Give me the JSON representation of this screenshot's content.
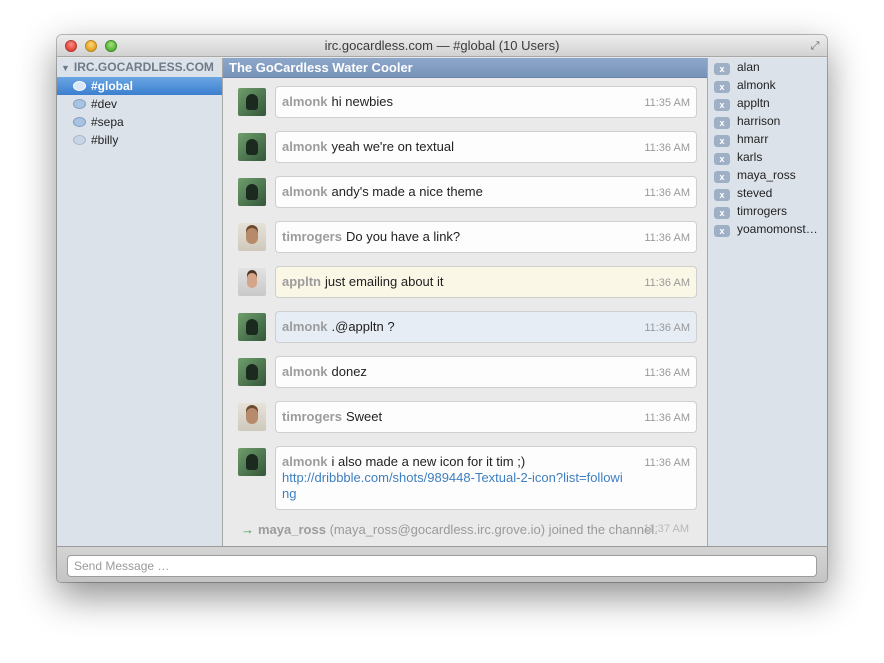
{
  "window": {
    "title": "irc.gocardless.com — #global (10 Users)"
  },
  "sidebar": {
    "server": "IRC.GOCARDLESS.COM",
    "channels": [
      {
        "name": "#global",
        "active": true
      },
      {
        "name": "#dev"
      },
      {
        "name": "#sepa"
      },
      {
        "name": "#billy"
      }
    ]
  },
  "chat": {
    "topic": "The GoCardless Water Cooler",
    "messages": [
      {
        "nick": "almonk",
        "text": "hi newbies",
        "time": "11:35 AM"
      },
      {
        "nick": "almonk",
        "text": "yeah we're on textual",
        "time": "11:36 AM"
      },
      {
        "nick": "almonk",
        "text": "andy's made a nice theme",
        "time": "11:36 AM"
      },
      {
        "nick": "timrogers",
        "text": "Do you have a link?",
        "time": "11:36 AM"
      },
      {
        "nick": "appltn",
        "text": "just emailing about it",
        "time": "11:36 AM"
      },
      {
        "nick": "almonk",
        "text": ".@appltn ?",
        "time": "11:36 AM"
      },
      {
        "nick": "almonk",
        "text": "donez",
        "time": "11:36 AM"
      },
      {
        "nick": "timrogers",
        "text": "Sweet",
        "time": "11:36 AM"
      },
      {
        "nick": "almonk",
        "text": "i also made a new icon for it tim ;)",
        "link": "http://dribbble.com/shots/989448-Textual-2-icon?list=following",
        "time": "11:36 AM"
      }
    ],
    "join": {
      "nick": "maya_ross",
      "text": "(maya_ross@gocardless.irc.grove.io) joined the channel.",
      "time": "11:37 AM"
    }
  },
  "users": [
    "alan",
    "almonk",
    "appltn",
    "harrison",
    "hmarr",
    "karls",
    "maya_ross",
    "steved",
    "timrogers",
    "yoamomonst…"
  ],
  "input": {
    "placeholder": "Send Message …"
  }
}
